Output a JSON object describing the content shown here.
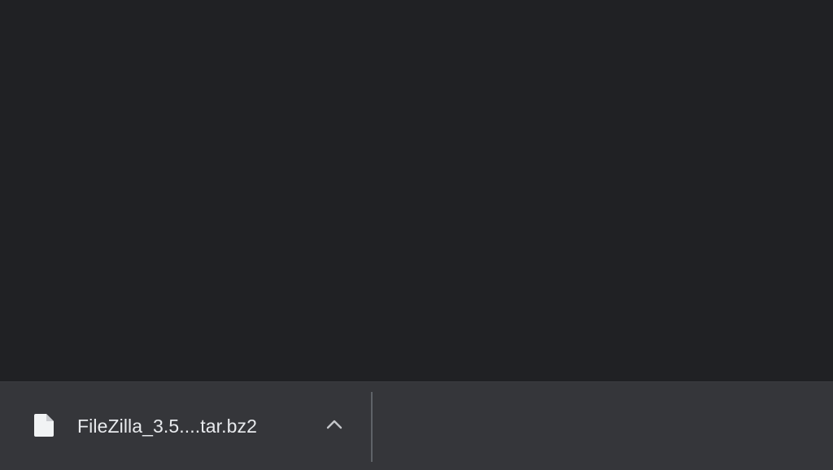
{
  "download_bar": {
    "items": [
      {
        "file_name": "FileZilla_3.5....tar.bz2",
        "icon": "file-icon",
        "menu_icon": "chevron-up-icon"
      }
    ]
  },
  "colors": {
    "page_background": "#202124",
    "bar_background": "#35363a",
    "text": "#e8eaed",
    "icon": "#f1f3f4",
    "divider": "#5f6368"
  }
}
